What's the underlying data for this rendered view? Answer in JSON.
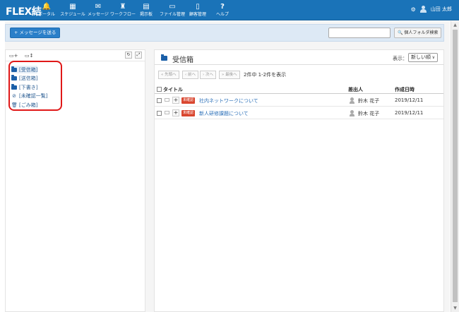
{
  "app": {
    "logo": "FLEX結",
    "user_name": "山田 太郎"
  },
  "nav": [
    {
      "label": "ポータル",
      "icon": "bell-icon",
      "glyph": "🔔"
    },
    {
      "label": "スケジュール",
      "icon": "calendar-icon",
      "glyph": "▦"
    },
    {
      "label": "メッセージ",
      "icon": "envelope-icon",
      "glyph": "✉"
    },
    {
      "label": "ワークフロー",
      "icon": "stamp-icon",
      "glyph": "♜"
    },
    {
      "label": "掲示板",
      "icon": "clipboard-icon",
      "glyph": "▤"
    },
    {
      "label": "ファイル管理",
      "icon": "folder-icon",
      "glyph": "▭"
    },
    {
      "label": "顧客管理",
      "icon": "book-icon",
      "glyph": "▯"
    },
    {
      "label": "ヘルプ",
      "icon": "help-icon",
      "glyph": "?"
    }
  ],
  "actionbar": {
    "send_label": "+ メッセージを送る",
    "search_value": "",
    "search_button_label": "🔍 個人フォルダ検索"
  },
  "left": {
    "folders": [
      {
        "label": "[受信箱]",
        "icon": "folder-icon"
      },
      {
        "label": "[送信箱]",
        "icon": "folder-icon"
      },
      {
        "label": "[下書き]",
        "icon": "folder-icon"
      },
      {
        "label": "[未確認一覧]",
        "icon": "check-circle-icon"
      },
      {
        "label": "[ごみ箱]",
        "icon": "trash-icon"
      }
    ]
  },
  "right": {
    "title": "受信箱",
    "display_label": "表示：",
    "display_option": "新しい順",
    "pager": {
      "first": "« 先頭へ",
      "prev": "‹ 前へ",
      "next": "› 次へ",
      "last": "» 最後へ"
    },
    "count": "2件中 1-2件を表示",
    "columns": {
      "title": "タイトル",
      "sender": "差出人",
      "date": "作成日時"
    },
    "rows": [
      {
        "badge": "未確認",
        "subject": "社内ネットワークについて",
        "sender": "鈴木 花子",
        "date": "2019/12/11"
      },
      {
        "badge": "未確認",
        "subject": "新人研修課題について",
        "sender": "鈴木 花子",
        "date": "2019/12/11"
      }
    ]
  },
  "colors": {
    "nav_bg": "#1a73b8",
    "accent": "#2a7fc9",
    "badge": "#d9462f",
    "highlight": "#e01818"
  }
}
